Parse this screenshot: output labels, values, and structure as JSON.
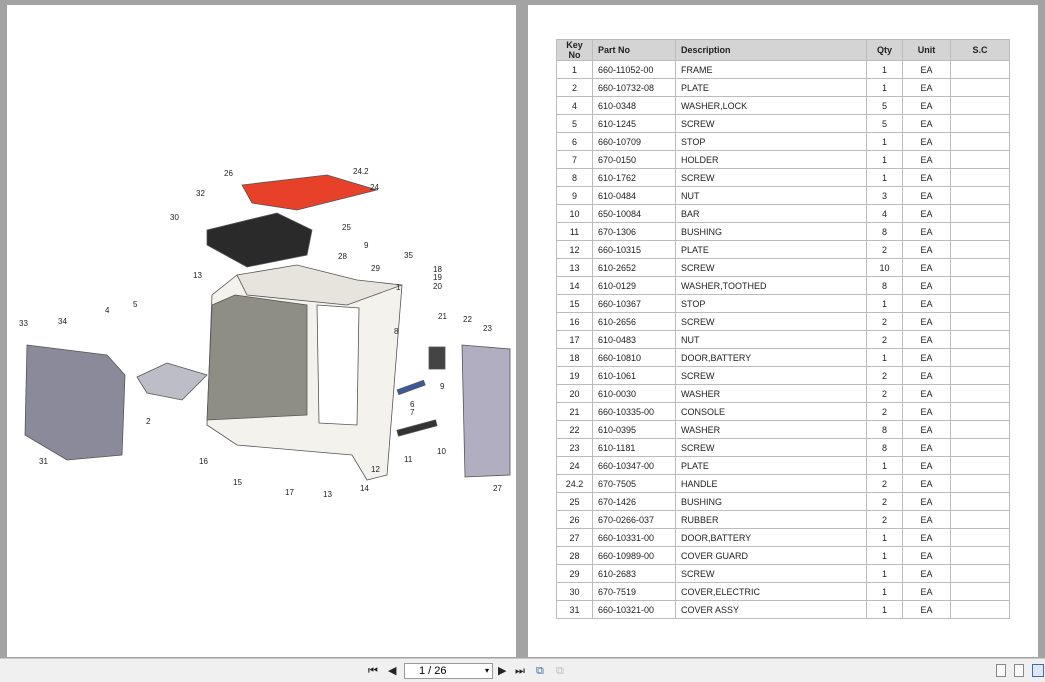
{
  "viewer": {
    "page_indicator": "1 / 26",
    "buttons": {
      "first": "first-page",
      "prev": "previous-page",
      "next": "next-page",
      "last": "last-page"
    },
    "icons": [
      "rotate-page-icon",
      "rotate-disabled-icon",
      "single-page-view-icon",
      "continuous-view-icon",
      "two-page-view-icon"
    ]
  },
  "diagram": {
    "callouts": [
      "24.2",
      "26",
      "24",
      "32",
      "30",
      "25",
      "9",
      "28",
      "35",
      "29",
      "18",
      "19",
      "20",
      "13",
      "1",
      "5",
      "4",
      "33",
      "34",
      "21",
      "22",
      "23",
      "8",
      "9",
      "6",
      "7",
      "2",
      "10",
      "11",
      "31",
      "16",
      "12",
      "15",
      "17",
      "14",
      "13",
      "27"
    ],
    "colors": {
      "highlight": "#e8412a",
      "part": "#8a8a9a",
      "frame": "#f4f2ec"
    }
  },
  "parts_table": {
    "headers": [
      "Key No",
      "Part No",
      "Description",
      "Qty",
      "Unit",
      "S.C"
    ],
    "rows": [
      [
        "1",
        "660-11052-00",
        "FRAME",
        "1",
        "EA",
        ""
      ],
      [
        "2",
        "660-10732-08",
        "PLATE",
        "1",
        "EA",
        ""
      ],
      [
        "4",
        "610-0348",
        "WASHER,LOCK",
        "5",
        "EA",
        ""
      ],
      [
        "5",
        "610-1245",
        "SCREW",
        "5",
        "EA",
        ""
      ],
      [
        "6",
        "660-10709",
        "STOP",
        "1",
        "EA",
        ""
      ],
      [
        "7",
        "670-0150",
        "HOLDER",
        "1",
        "EA",
        ""
      ],
      [
        "8",
        "610-1762",
        "SCREW",
        "1",
        "EA",
        ""
      ],
      [
        "9",
        "610-0484",
        "NUT",
        "3",
        "EA",
        ""
      ],
      [
        "10",
        "650-10084",
        "BAR",
        "4",
        "EA",
        ""
      ],
      [
        "11",
        "670-1306",
        "BUSHING",
        "8",
        "EA",
        ""
      ],
      [
        "12",
        "660-10315",
        "PLATE",
        "2",
        "EA",
        ""
      ],
      [
        "13",
        "610-2652",
        "SCREW",
        "10",
        "EA",
        ""
      ],
      [
        "14",
        "610-0129",
        "WASHER,TOOTHED",
        "8",
        "EA",
        ""
      ],
      [
        "15",
        "660-10367",
        "STOP",
        "1",
        "EA",
        ""
      ],
      [
        "16",
        "610-2656",
        "SCREW",
        "2",
        "EA",
        ""
      ],
      [
        "17",
        "610-0483",
        "NUT",
        "2",
        "EA",
        ""
      ],
      [
        "18",
        "660-10810",
        "DOOR,BATTERY",
        "1",
        "EA",
        ""
      ],
      [
        "19",
        "610-1061",
        "SCREW",
        "2",
        "EA",
        ""
      ],
      [
        "20",
        "610-0030",
        "WASHER",
        "2",
        "EA",
        ""
      ],
      [
        "21",
        "660-10335-00",
        "CONSOLE",
        "2",
        "EA",
        ""
      ],
      [
        "22",
        "610-0395",
        "WASHER",
        "8",
        "EA",
        ""
      ],
      [
        "23",
        "610-1181",
        "SCREW",
        "8",
        "EA",
        ""
      ],
      [
        "24",
        "660-10347-00",
        "PLATE",
        "1",
        "EA",
        ""
      ],
      [
        "24.2",
        "670-7505",
        "HANDLE",
        "2",
        "EA",
        ""
      ],
      [
        "25",
        "670-1426",
        "BUSHING",
        "2",
        "EA",
        ""
      ],
      [
        "26",
        "670-0266-037",
        "RUBBER",
        "2",
        "EA",
        ""
      ],
      [
        "27",
        "660-10331-00",
        "DOOR,BATTERY",
        "1",
        "EA",
        ""
      ],
      [
        "28",
        "660-10989-00",
        "COVER GUARD",
        "1",
        "EA",
        ""
      ],
      [
        "29",
        "610-2683",
        "SCREW",
        "1",
        "EA",
        ""
      ],
      [
        "30",
        "670-7519",
        "COVER,ELECTRIC",
        "1",
        "EA",
        ""
      ],
      [
        "31",
        "660-10321-00",
        "COVER ASSY",
        "1",
        "EA",
        ""
      ]
    ]
  }
}
